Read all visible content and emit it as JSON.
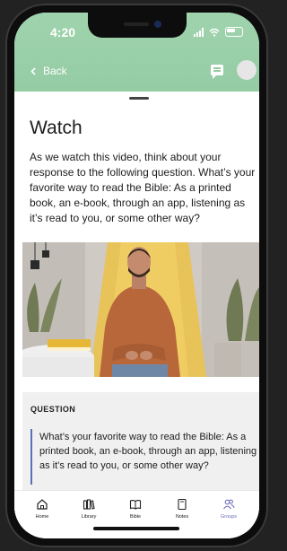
{
  "status": {
    "time": "4:20"
  },
  "header": {
    "back_label": "Back"
  },
  "content": {
    "title": "Watch",
    "intro": "As we watch this video, think about your response to the following question. What’s your favorite way to read the Bible: As a printed book, an e-book, through an app, listening as it’s read to you, or some other way?"
  },
  "question": {
    "label": "QUESTION",
    "text": "What’s your favorite way to read the Bible: As a printed book, an e-book, through an app, listening as it’s read to you, or some other way?"
  },
  "tabs": [
    {
      "label": "Home",
      "icon": "home-icon"
    },
    {
      "label": "Library",
      "icon": "library-icon"
    },
    {
      "label": "Bible",
      "icon": "bible-icon"
    },
    {
      "label": "Notes",
      "icon": "notes-icon"
    },
    {
      "label": "Groups",
      "icon": "groups-icon",
      "active": true
    }
  ],
  "colors": {
    "header": "#94cba3",
    "accent": "#5a6fb7",
    "active_tab": "#6b6bb8"
  }
}
